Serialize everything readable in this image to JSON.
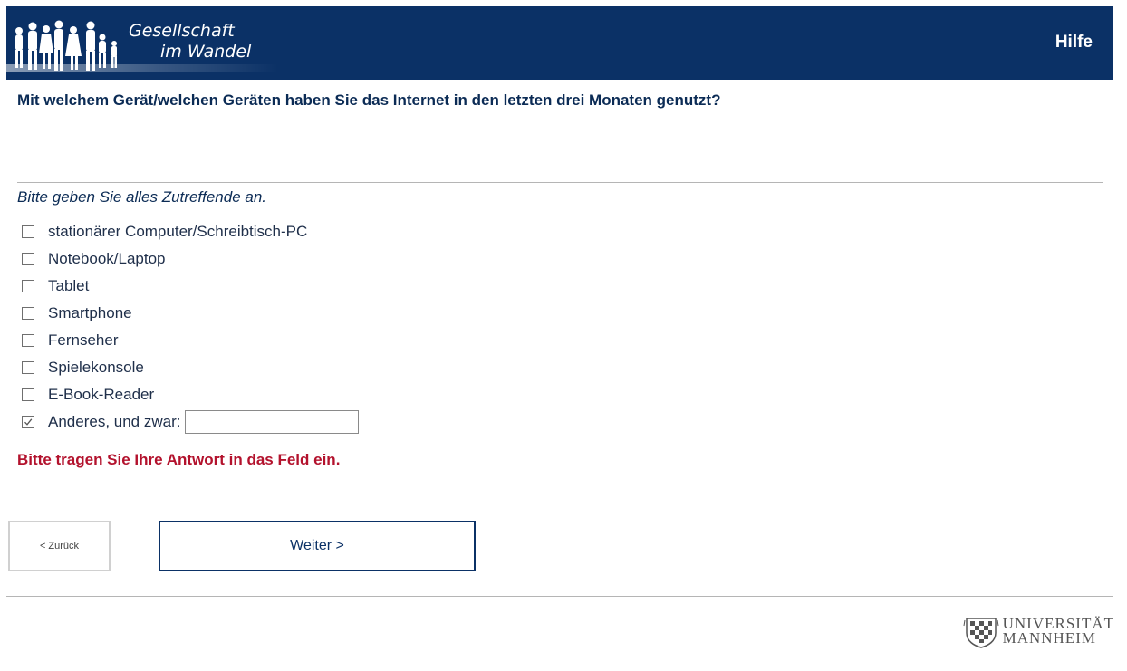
{
  "header": {
    "logo_line1": "Gesellschaft",
    "logo_line2": "im Wandel",
    "help_label": "Hilfe",
    "background_color": "#0b3166"
  },
  "question": "Mit welchem Gerät/welchen Geräten haben Sie das Internet in den letzten drei Monaten genutzt?",
  "instruction": "Bitte geben Sie alles Zutreffende an.",
  "options": [
    {
      "label": "stationärer Computer/Schreibtisch-PC",
      "checked": false
    },
    {
      "label": "Notebook/Laptop",
      "checked": false
    },
    {
      "label": "Tablet",
      "checked": false
    },
    {
      "label": "Smartphone",
      "checked": false
    },
    {
      "label": "Fernseher",
      "checked": false
    },
    {
      "label": "Spielekonsole",
      "checked": false
    },
    {
      "label": "E-Book-Reader",
      "checked": false
    },
    {
      "label": "Anderes, und zwar:",
      "checked": true
    }
  ],
  "other_input": {
    "value": "",
    "placeholder": ""
  },
  "error_message": "Bitte tragen Sie Ihre Antwort in das Feld ein.",
  "error_color": "#b3122d",
  "buttons": {
    "back_label": "< Zurück",
    "next_label": "Weiter >"
  },
  "footer": {
    "university_line1": "UNIVERSITÄT",
    "university_line2": "MANNHEIM"
  },
  "icons": {
    "logo": "people-silhouette-icon",
    "checkbox_checked": "checkmark-icon",
    "university": "mannheim-crest-icon"
  }
}
